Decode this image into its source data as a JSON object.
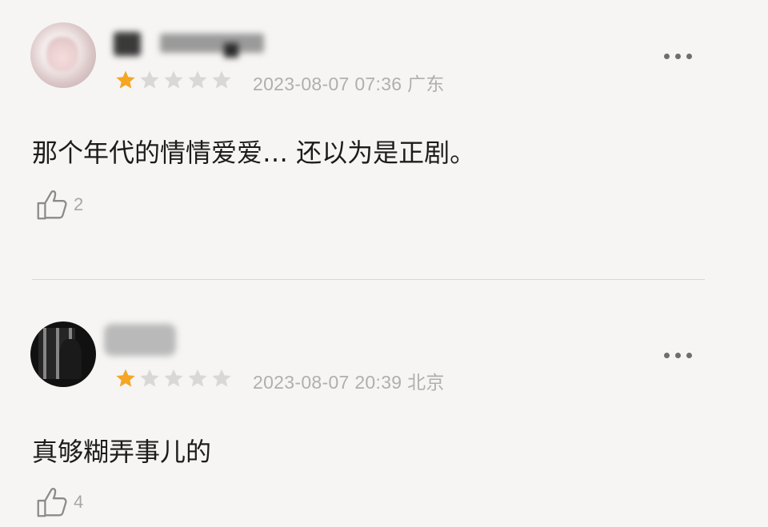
{
  "comments": [
    {
      "rating": 1,
      "max_rating": 5,
      "timestamp": "2023-08-07 07:36",
      "location": "广东",
      "text": "那个年代的情情爱爱… 还以为是正剧。",
      "likes": "2",
      "icons": {
        "like": "thumbs-up-icon",
        "more": "more-dots-icon"
      }
    },
    {
      "rating": 1,
      "max_rating": 5,
      "timestamp": "2023-08-07 20:39",
      "location": "北京",
      "text": "真够糊弄事儿的",
      "likes": "4",
      "icons": {
        "like": "thumbs-up-icon",
        "more": "more-dots-icon"
      }
    }
  ],
  "colors": {
    "star_filled": "#f5a623",
    "star_empty": "#d9d8d5",
    "meta_text": "#b0afab",
    "background": "#f6f5f3"
  }
}
